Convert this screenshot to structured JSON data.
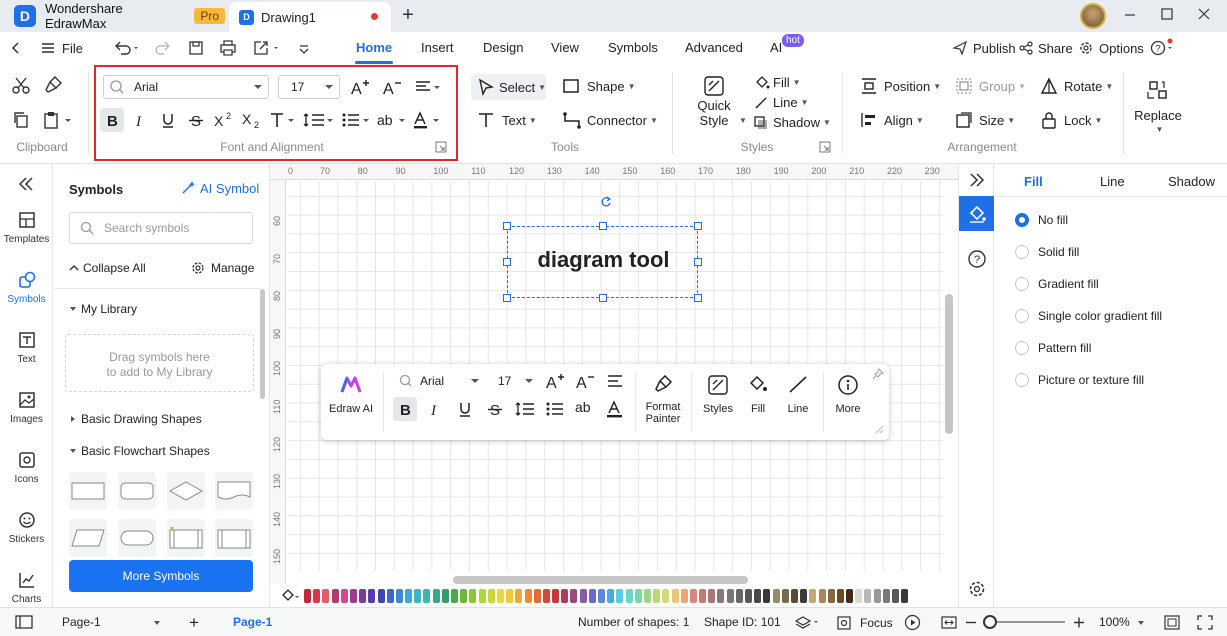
{
  "titlebar": {
    "app_name": "Wondershare EdrawMax",
    "badge": "Pro",
    "logo_letter": "D",
    "doc_tab": "Drawing1",
    "new_tab": "+"
  },
  "menubar": {
    "file": "File",
    "tabs": [
      "Home",
      "Insert",
      "Design",
      "View",
      "Symbols",
      "Advanced",
      "AI"
    ],
    "active_tab": "Home",
    "hot_badge": "hot",
    "publish": "Publish",
    "share": "Share",
    "options": "Options"
  },
  "ribbon": {
    "clipboard_label": "Clipboard",
    "font": {
      "family": "Arial",
      "size": "17",
      "group_label": "Font and Alignment"
    },
    "tools": {
      "select": "Select",
      "shape": "Shape",
      "text": "Text",
      "connector": "Connector",
      "group_label": "Tools"
    },
    "styles": {
      "quick_style_line1": "Quick",
      "quick_style_line2": "Style",
      "fill": "Fill",
      "line": "Line",
      "shadow": "Shadow",
      "group_label": "Styles"
    },
    "arrangement": {
      "position": "Position",
      "group": "Group",
      "rotate": "Rotate",
      "align": "Align",
      "size": "Size",
      "lock": "Lock",
      "group_label": "Arrangement"
    },
    "replace": "Replace"
  },
  "rail": {
    "items": [
      "Templates",
      "Symbols",
      "Text",
      "Images",
      "Icons",
      "Stickers",
      "Charts"
    ],
    "active": "Symbols"
  },
  "symbols_panel": {
    "title": "Symbols",
    "ai_symbol": "AI Symbol",
    "search_placeholder": "Search symbols",
    "collapse_all": "Collapse All",
    "manage": "Manage",
    "my_library": "My Library",
    "drop_hint_line1": "Drag symbols here",
    "drop_hint_line2": "to add to My Library",
    "section1": "Basic Drawing Shapes",
    "section2": "Basic Flowchart Shapes",
    "more_button": "More Symbols"
  },
  "rulers": {
    "horizontal": [
      "0",
      "70",
      "80",
      "90",
      "100",
      "110",
      "120",
      "130",
      "140",
      "150",
      "160",
      "170",
      "180",
      "190",
      "200",
      "210",
      "220",
      "230"
    ],
    "vertical": [
      "60",
      "70",
      "80",
      "90",
      "100",
      "110",
      "120",
      "130",
      "140",
      "150"
    ]
  },
  "canvas": {
    "shape_text": "diagram tool"
  },
  "floating_toolbar": {
    "edraw_ai": "Edraw AI",
    "font": "Arial",
    "size": "17",
    "format_painter_line1": "Format",
    "format_painter_line2": "Painter",
    "styles": "Styles",
    "fill": "Fill",
    "line": "Line",
    "more": "More"
  },
  "color_strip": [
    "#c0283a",
    "#d63a4a",
    "#e35a6a",
    "#b23a6e",
    "#d24a8a",
    "#a03a8a",
    "#7a3aa0",
    "#5a3ab0",
    "#3a4ab0",
    "#3a6ac8",
    "#3a8ad8",
    "#3aa8d8",
    "#3ab8c8",
    "#3ab8a8",
    "#3aa888",
    "#3a9a6a",
    "#4aaa4a",
    "#6aba3a",
    "#8ac83a",
    "#aad83a",
    "#c8d83a",
    "#e8d83a",
    "#f0c83a",
    "#f0a83a",
    "#f0883a",
    "#e8683a",
    "#d8483a",
    "#c83a3a",
    "#b83a5a",
    "#9a4a7a",
    "#8a5aaa",
    "#6a6ac8",
    "#5a8ad8",
    "#4aa8e8",
    "#5ac8e8",
    "#6ad8c8",
    "#7ad8a8",
    "#9ad888",
    "#bad878",
    "#d8d878",
    "#e8c878",
    "#e8a878",
    "#d88878",
    "#c87878",
    "#a87878",
    "#887878",
    "#787878",
    "#686868",
    "#585858",
    "#484848",
    "#383838",
    "#9a8a6a",
    "#7a6a4a",
    "#5a4a3a",
    "#3a3a3a",
    "#c8a878",
    "#a88858",
    "#886838",
    "#684828",
    "#482818",
    "#d8d8d8",
    "#b8b8b8",
    "#989898",
    "#787878",
    "#585858",
    "#383838"
  ],
  "right_panel": {
    "tabs": [
      "Fill",
      "Line",
      "Shadow"
    ],
    "active_tab": "Fill",
    "options": [
      "No fill",
      "Solid fill",
      "Gradient fill",
      "Single color gradient fill",
      "Pattern fill",
      "Picture or texture fill"
    ],
    "selected_option": "No fill"
  },
  "statusbar": {
    "page_select": "Page-1",
    "page_tab": "Page-1",
    "add_page": "+",
    "num_shapes": "Number of shapes: 1",
    "shape_id": "Shape ID: 101",
    "focus": "Focus",
    "zoom": "100%"
  },
  "colors": {
    "accent": "#1f6fe5",
    "highlight_box": "#e5262b",
    "pro_badge": "#f6b73c",
    "hot_badge": "#7b5cf0"
  }
}
